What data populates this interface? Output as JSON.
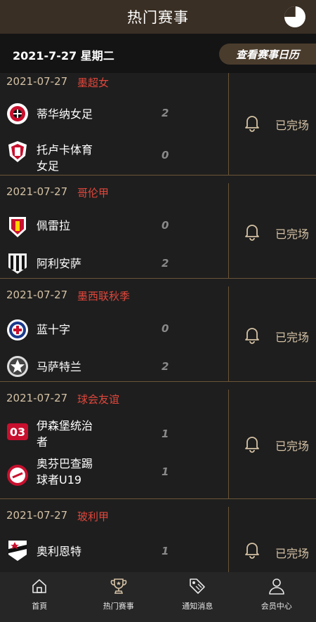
{
  "header": {
    "title": "热门赛事"
  },
  "date_bar": {
    "date": "2021-7-27 星期二",
    "calendar_button": "查看赛事日历"
  },
  "matches": [
    {
      "date": "2021-07-27",
      "league": "墨超女",
      "home": "蒂华纳女足",
      "home_score": "2",
      "away": "托卢卡体育女足",
      "away_score": "0",
      "status": "已完场"
    },
    {
      "date": "2021-07-27",
      "league": "哥伦甲",
      "home": "佩雷拉",
      "home_score": "0",
      "away": "阿利安萨",
      "away_score": "2",
      "status": "已完场"
    },
    {
      "date": "2021-07-27",
      "league": "墨西联秋季",
      "home": "蓝十字",
      "home_score": "0",
      "away": "马萨特兰",
      "away_score": "2",
      "status": "已完场"
    },
    {
      "date": "2021-07-27",
      "league": "球会友谊",
      "home": "伊森堡统治者",
      "home_score": "1",
      "away": "奥芬巴查踢球者U19",
      "away_score": "1",
      "status": "已完场"
    },
    {
      "date": "2021-07-27",
      "league": "玻利甲",
      "home": "奥利恩特",
      "home_score": "1",
      "status": "已完场"
    }
  ],
  "tabs": [
    {
      "label": "首頁",
      "icon": "home-icon"
    },
    {
      "label": "热门赛事",
      "icon": "trophy-icon"
    },
    {
      "label": "通知消息",
      "icon": "tag-icon"
    },
    {
      "label": "会员中心",
      "icon": "user-icon"
    }
  ],
  "colors": {
    "header_bg": "#3a2f24",
    "accent": "#d5c2a5",
    "league": "#e0473c",
    "divider": "#6b5538"
  }
}
